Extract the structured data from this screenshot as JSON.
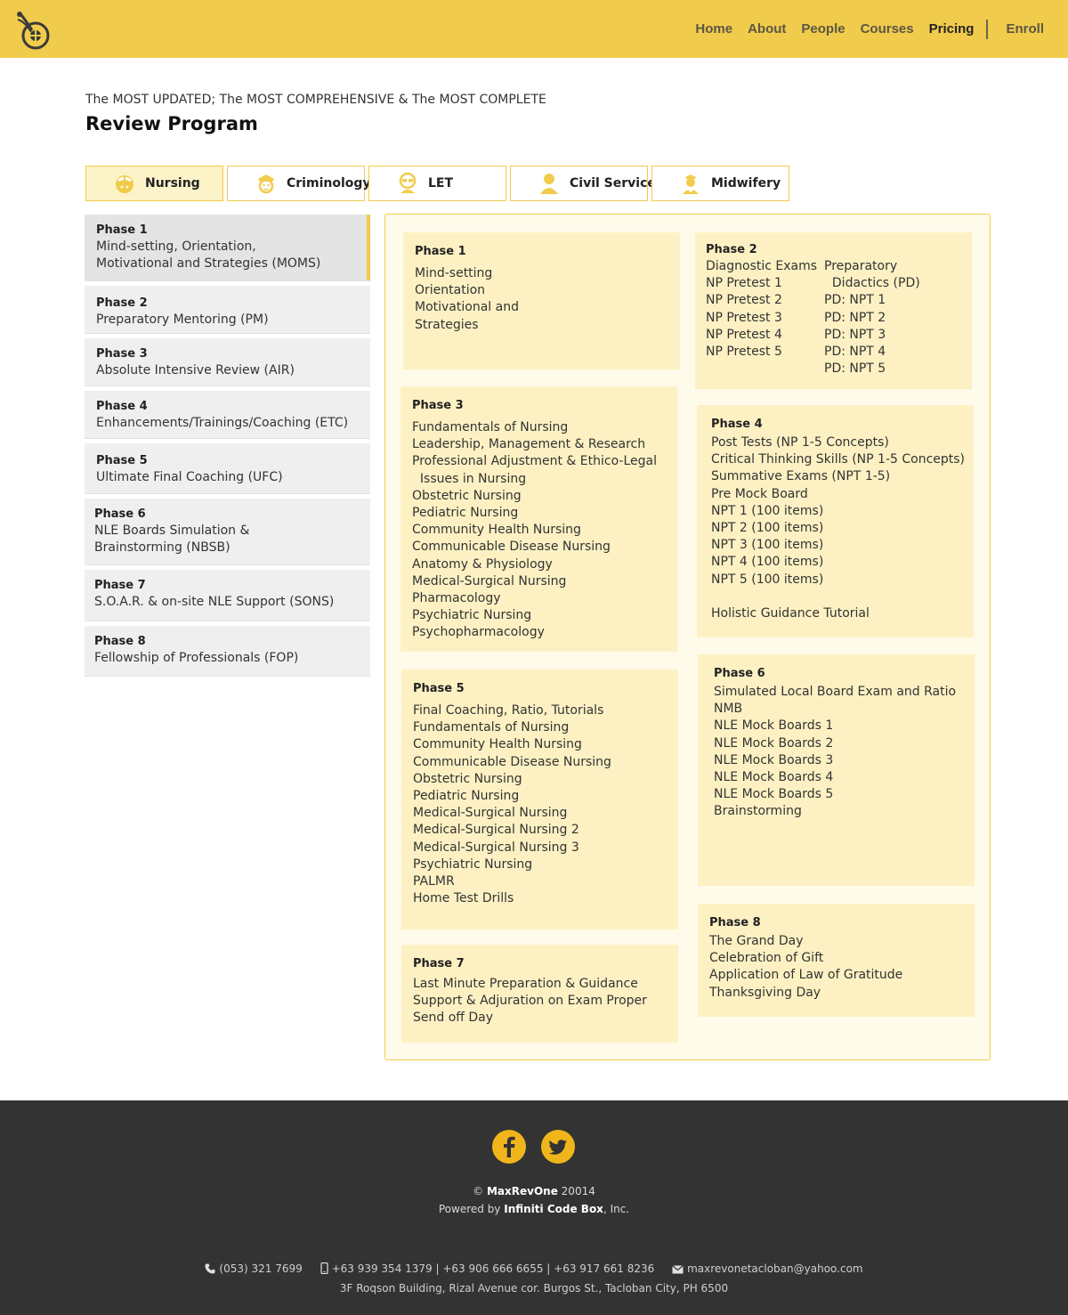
{
  "nav": {
    "items": [
      "Home",
      "About",
      "People",
      "Courses",
      "Pricing"
    ],
    "active": "Pricing",
    "enroll": "Enroll"
  },
  "intro": {
    "tagline": "The MOST UPDATED; The MOST COMPREHENSIVE & The MOST COMPLETE",
    "title": "Review Program"
  },
  "tabs": [
    {
      "label": "Nursing",
      "icon": "nurse-icon",
      "active": true
    },
    {
      "label": "Criminology",
      "icon": "police-icon",
      "active": false
    },
    {
      "label": "LET",
      "icon": "teacher-icon",
      "active": false
    },
    {
      "label": "Civil Service",
      "icon": "civil-servant-icon",
      "active": false
    },
    {
      "label": "Midwifery",
      "icon": "midwife-icon",
      "active": false
    }
  ],
  "phases": [
    {
      "title": "Phase 1",
      "desc": [
        "Mind-setting, Orientation,",
        "Motivational and Strategies (MOMS)"
      ]
    },
    {
      "title": "Phase 2",
      "desc": [
        "Preparatory Mentoring (PM)"
      ]
    },
    {
      "title": "Phase 3",
      "desc": [
        "Absolute Intensive Review (AIR)"
      ]
    },
    {
      "title": "Phase 4",
      "desc": [
        "Enhancements/Trainings/Coaching (ETC)"
      ]
    },
    {
      "title": "Phase 5",
      "desc": [
        "Ultimate Final Coaching (UFC)"
      ]
    },
    {
      "title": "Phase 6",
      "desc": [
        "NLE Boards Simulation &",
        "Brainstorming (NBSB)"
      ]
    },
    {
      "title": "Phase 7",
      "desc": [
        "S.O.A.R. & on-site NLE Support  (SONS)"
      ]
    },
    {
      "title": "Phase 8",
      "desc": [
        "Fellowship of Professionals (FOP)"
      ]
    }
  ],
  "cards": {
    "p1": {
      "title": "Phase 1",
      "lines": [
        "Mind-setting",
        "Orientation",
        "Motivational and",
        "Strategies"
      ]
    },
    "p2": {
      "title": "Phase 2",
      "col_a": [
        "Diagnostic Exams",
        "NP Pretest 1",
        "NP Pretest 2",
        "NP Pretest 3",
        "NP Pretest 4",
        "NP Pretest 5"
      ],
      "col_b": [
        "Preparatory",
        "  Didactics (PD)",
        "PD: NPT 1",
        "PD: NPT 2",
        "PD: NPT 3",
        "PD: NPT 4",
        "PD: NPT 5"
      ]
    },
    "p3": {
      "title": "Phase 3",
      "lines": [
        "Fundamentals of Nursing",
        "Leadership, Management & Research",
        "Professional Adjustment & Ethico-Legal",
        "  Issues in Nursing",
        "Obstetric Nursing",
        "Pediatric Nursing",
        "Community Health Nursing",
        "Communicable Disease Nursing",
        "Anatomy & Physiology",
        "Medical-Surgical Nursing",
        "Pharmacology",
        "Psychiatric Nursing",
        "Psychopharmacology"
      ]
    },
    "p4": {
      "title": "Phase 4",
      "lines": [
        "Post Tests (NP 1-5 Concepts)",
        "Critical Thinking Skills (NP 1-5 Concepts)",
        "Summative Exams (NPT 1-5)",
        "Pre Mock Board",
        "NPT 1 (100 items)",
        "NPT 2 (100 items)",
        "NPT 3 (100 items)",
        "NPT 4 (100 items)",
        "NPT 5 (100 items)",
        "",
        "Holistic Guidance Tutorial"
      ]
    },
    "p5": {
      "title": "Phase 5",
      "lines": [
        "Final Coaching, Ratio, Tutorials",
        "Fundamentals of Nursing",
        "Community Health Nursing",
        "Communicable Disease Nursing",
        "Obstetric Nursing",
        "Pediatric Nursing",
        "Medical-Surgical Nursing",
        "Medical-Surgical Nursing 2",
        "Medical-Surgical Nursing 3",
        "Psychiatric Nursing",
        "PALMR",
        "Home Test Drills"
      ]
    },
    "p6": {
      "title": "Phase 6",
      "lines": [
        "Simulated Local Board Exam and Ratio",
        "NMB",
        "NLE Mock Boards 1",
        "NLE Mock Boards 2",
        "NLE Mock Boards 3",
        "NLE Mock Boards 4",
        "NLE Mock Boards 5",
        "Brainstorming"
      ]
    },
    "p7": {
      "title": "Phase 7",
      "lines": [
        "Last Minute Preparation & Guidance",
        "Support & Adjuration on Exam Proper",
        "Send off Day"
      ]
    },
    "p8": {
      "title": "Phase 8",
      "lines": [
        "The Grand Day",
        "Celebration of Gift",
        "Application of Law of Gratitude",
        "Thanksgiving Day"
      ]
    }
  },
  "footer": {
    "social": [
      "facebook-icon",
      "twitter-icon"
    ],
    "copyright_symbol": "©",
    "brand": "MaxRevOne",
    "year": "20014",
    "powered_prefix": "Powered by",
    "powered_brand": "Infiniti Code Box",
    "powered_suffix": ", Inc.",
    "landline": "(053) 321 7699",
    "mobiles": "+63 939 354 1379 | +63 906 666 6655 | +63 917 661 8236",
    "email": "maxrevonetacloban@yahoo.com",
    "address": "3F Roqson Building, Rizal Avenue cor. Burgos St., Tacloban City, PH 6500"
  },
  "colors": {
    "accent": "#f1cb4b",
    "card": "#fdf1c3",
    "panel": "#fffbea",
    "footer": "#333333",
    "social": "#f1b51c"
  }
}
